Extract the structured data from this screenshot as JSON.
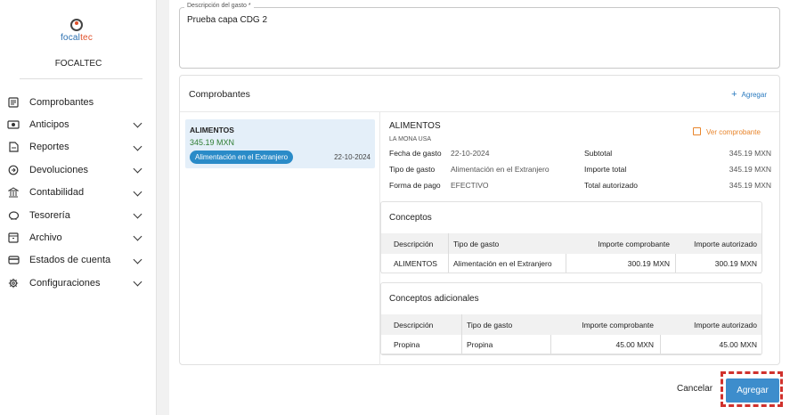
{
  "sidebar": {
    "logo": {
      "part1": "focal",
      "part2": "tec"
    },
    "company": "FOCALTEC",
    "items": [
      {
        "label": "Comprobantes",
        "icon": "document-list-icon",
        "expandable": false
      },
      {
        "label": "Anticipos",
        "icon": "cash-icon",
        "expandable": true
      },
      {
        "label": "Reportes",
        "icon": "file-report-icon",
        "expandable": true
      },
      {
        "label": "Devoluciones",
        "icon": "refresh-icon",
        "expandable": true
      },
      {
        "label": "Contabilidad",
        "icon": "bank-icon",
        "expandable": true
      },
      {
        "label": "Tesorería",
        "icon": "piggy-bank-icon",
        "expandable": true
      },
      {
        "label": "Archivo",
        "icon": "archive-icon",
        "expandable": true
      },
      {
        "label": "Estados de cuenta",
        "icon": "credit-card-icon",
        "expandable": true
      },
      {
        "label": "Configuraciones",
        "icon": "gear-icon",
        "expandable": true
      }
    ]
  },
  "description": {
    "label": "Descripción del gasto *",
    "value": "Prueba capa CDG 2"
  },
  "comprobantes": {
    "title": "Comprobantes",
    "add_label": "Agregar",
    "list": [
      {
        "title": "ALIMENTOS",
        "amount": "345.19 MXN",
        "badge": "Alimentación en el Extranjero",
        "date": "22-10-2024"
      }
    ],
    "detail": {
      "title": "ALIMENTOS",
      "vendor": "LA MONA USA",
      "ver_label": "Ver comprobante",
      "fecha_label": "Fecha de gasto",
      "fecha": "22-10-2024",
      "tipo_label": "Tipo de gasto",
      "tipo": "Alimentación en el Extranjero",
      "forma_label": "Forma de pago",
      "forma": "EFECTIVO",
      "subtotal_label": "Subtotal",
      "subtotal": "345.19 MXN",
      "importe_total_label": "Importe total",
      "importe_total": "345.19 MXN",
      "total_aut_label": "Total autorizado",
      "total_aut": "345.19 MXN"
    },
    "conceptos": {
      "title": "Conceptos",
      "headers": [
        "Descripción",
        "Tipo de gasto",
        "Importe comprobante",
        "Importe autorizado"
      ],
      "rows": [
        [
          "ALIMENTOS",
          "Alimentación en el Extranjero",
          "300.19 MXN",
          "300.19 MXN"
        ]
      ]
    },
    "adicionales": {
      "title": "Conceptos adicionales",
      "headers": [
        "Descripción",
        "Tipo de gasto",
        "Importe comprobante",
        "Importe autorizado"
      ],
      "rows": [
        [
          "Propina",
          "Propina",
          "45.00 MXN",
          "45.00 MXN"
        ]
      ]
    }
  },
  "footer": {
    "cancel_label": "Cancelar",
    "submit_label": "Agregar"
  },
  "colors": {
    "accent": "#3d8dcc",
    "link": "#2a7abf",
    "amount": "#2e7d32",
    "ver": "#e8852c",
    "highlight": "#d0312d"
  }
}
